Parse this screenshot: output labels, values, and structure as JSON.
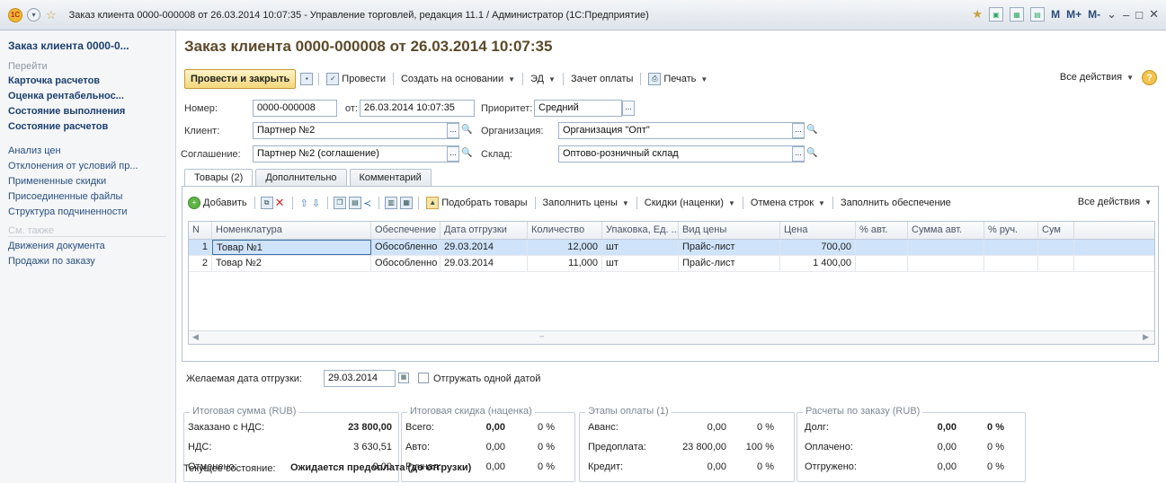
{
  "window": {
    "title": "Заказ клиента 0000-000008 от 26.03.2014 10:07:35 - Управление торговлей, редакция 11.1 / Администратор (1С:Предприятие)",
    "m_labels": [
      "M",
      "M+",
      "M-"
    ]
  },
  "sidebar": {
    "title": "Заказ клиента 0000-0...",
    "go_section": "Перейти",
    "bold_links": [
      "Карточка расчетов",
      "Оценка рентабельнос...",
      "Состояние выполнения",
      "Состояние расчетов"
    ],
    "links": [
      "Анализ цен",
      "Отклонения от условий пр...",
      "Примененные скидки",
      "Присоединенные файлы",
      "Структура подчиненности"
    ],
    "see_also_section": "См. также",
    "see_also_links": [
      "Движения документа",
      "Продажи по заказу"
    ]
  },
  "document": {
    "title": "Заказ клиента 0000-000008 от 26.03.2014 10:07:35"
  },
  "toolbar": {
    "post_and_close": "Провести и закрыть",
    "post": "Провести",
    "create_based_on": "Создать на основании",
    "ed": "ЭД",
    "offset_payment": "Зачет оплаты",
    "print": "Печать",
    "all_actions": "Все действия",
    "help": "?"
  },
  "form": {
    "number_label": "Номер:",
    "number_value": "0000-000008",
    "date_label": "от:",
    "date_value": "26.03.2014 10:07:35",
    "priority_label": "Приоритет:",
    "priority_value": "Средний",
    "client_label": "Клиент:",
    "client_value": "Партнер №2",
    "organization_label": "Организация:",
    "organization_value": "Организация \"Опт\"",
    "agreement_label": "Соглашение:",
    "agreement_value": "Партнер №2 (соглашение)",
    "warehouse_label": "Склад:",
    "warehouse_value": "Оптово-розничный склад"
  },
  "tabs": [
    "Товары (2)",
    "Дополнительно",
    "Комментарий"
  ],
  "table_toolbar": {
    "add": "Добавить",
    "pick_goods": "Подобрать товары",
    "fill_prices": "Заполнить цены",
    "discounts": "Скидки (наценки)",
    "cancel_rows": "Отмена строк",
    "fill_supply": "Заполнить обеспечение",
    "all_actions": "Все действия"
  },
  "table": {
    "columns": [
      "N",
      "Номенклатура",
      "Обеспечение",
      "Дата отгрузки",
      "Количество",
      "Упаковка, Ед. ...",
      "Вид цены",
      "Цена",
      "% авт.",
      "Сумма авт.",
      "% руч.",
      "Сум"
    ],
    "rows": [
      [
        "1",
        "Товар №1",
        "Обособленно",
        "29.03.2014",
        "12,000",
        "шт",
        "Прайс-лист",
        "700,00",
        "",
        "",
        "",
        ""
      ],
      [
        "2",
        "Товар №2",
        "Обособленно",
        "29.03.2014",
        "11,000",
        "шт",
        "Прайс-лист",
        "1 400,00",
        "",
        "",
        "",
        ""
      ]
    ]
  },
  "shipping": {
    "desired_date_label": "Желаемая дата отгрузки:",
    "desired_date_value": "29.03.2014",
    "one_date_label": "Отгружать одной датой"
  },
  "totals": {
    "title": "Итоговая сумма (RUB)",
    "ordered_label": "Заказано с НДС:",
    "ordered_value": "23 800,00",
    "vat_label": "НДС:",
    "vat_value": "3 630,51",
    "canceled_label": "Отменено:",
    "canceled_value": "0,00"
  },
  "discount": {
    "title": "Итоговая скидка (наценка)",
    "total_label": "Всего:",
    "total_value": "0,00",
    "total_pct": "0 %",
    "auto_label": "Авто:",
    "auto_value": "0,00",
    "auto_pct": "0 %",
    "manual_label": "Ручная:",
    "manual_value": "0,00",
    "manual_pct": "0 %"
  },
  "payment_stages": {
    "title": "Этапы оплаты (1)",
    "advance_label": "Аванс:",
    "advance_value": "0,00",
    "advance_pct": "0 %",
    "prepay_label": "Предоплата:",
    "prepay_value": "23 800,00",
    "prepay_pct": "100 %",
    "credit_label": "Кредит:",
    "credit_value": "0,00",
    "credit_pct": "0 %"
  },
  "settlements": {
    "title": "Расчеты по заказу (RUB)",
    "debt_label": "Долг:",
    "debt_value": "0,00",
    "debt_pct": "0 %",
    "paid_label": "Оплачено:",
    "paid_value": "0,00",
    "paid_pct": "0 %",
    "shipped_label": "Отгружено:",
    "shipped_value": "0,00",
    "shipped_pct": "0 %"
  },
  "status": {
    "label": "Текущее состояние:",
    "value": "Ожидается предоплата (до отгрузки)"
  },
  "colors": {
    "accent_button": "#f3d77b",
    "selected_row": "#cfe3fa",
    "title_text": "#5b4a2a",
    "link_text": "#1c3f6e"
  }
}
